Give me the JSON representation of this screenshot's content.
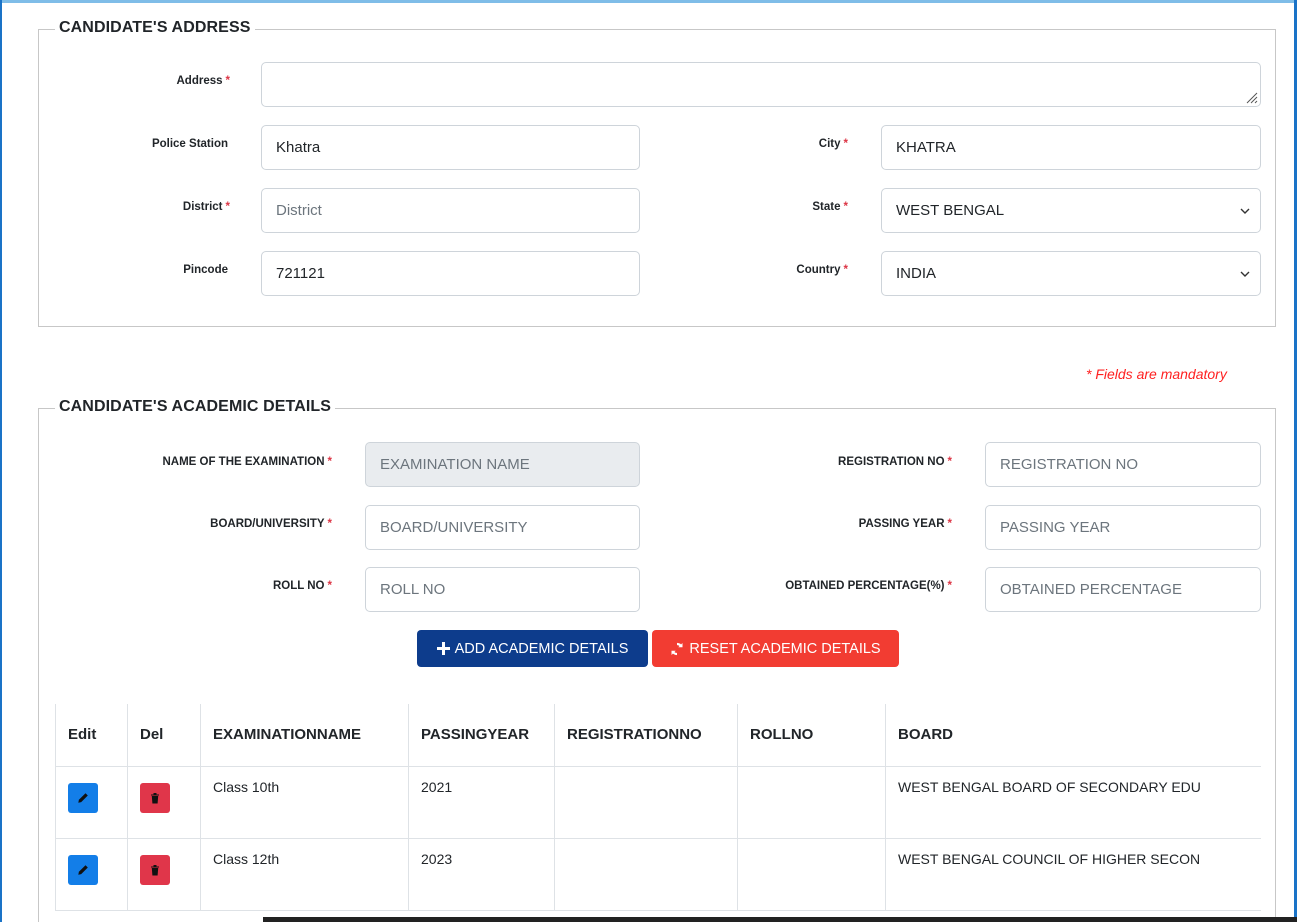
{
  "address_section": {
    "legend": "CANDIDATE'S ADDRESS",
    "address_label": "Address",
    "address_value": "",
    "police_station_label": "Police Station",
    "police_station_value": "Khatra",
    "city_label": "City",
    "city_value": "KHATRA",
    "district_label": "District",
    "district_placeholder": "District",
    "state_label": "State",
    "state_value": "WEST BENGAL",
    "pincode_label": "Pincode",
    "pincode_value": "721121",
    "country_label": "Country",
    "country_value": "INDIA",
    "required_mark": "*"
  },
  "mandatory_note": "* Fields are mandatory",
  "academic_section": {
    "legend": "CANDIDATE'S ACADEMIC DETAILS",
    "exam_name_label": "NAME OF THE EXAMINATION",
    "exam_name_placeholder": "EXAMINATION NAME",
    "registration_label": "REGISTRATION NO",
    "registration_placeholder": "REGISTRATION NO",
    "board_label": "BOARD/UNIVERSITY",
    "board_placeholder": "BOARD/UNIVERSITY",
    "passing_year_label": "PASSING YEAR",
    "passing_year_placeholder": "PASSING YEAR",
    "roll_label": "ROLL NO",
    "roll_placeholder": "ROLL NO",
    "percentage_label": "OBTAINED PERCENTAGE(%)",
    "percentage_placeholder": "OBTAINED PERCENTAGE",
    "add_button": "ADD ACADEMIC DETAILS",
    "reset_button": "RESET ACADEMIC DETAILS"
  },
  "table": {
    "headers": [
      "Edit",
      "Del",
      "EXAMINATIONNAME",
      "PASSINGYEAR",
      "REGISTRATIONNO",
      "ROLLNO",
      "BOARD"
    ],
    "rows": [
      {
        "exam": "Class 10th",
        "year": "2021",
        "reg": "",
        "roll": "",
        "board": "WEST BENGAL BOARD OF SECONDARY EDU"
      },
      {
        "exam": "Class 12th",
        "year": "2023",
        "reg": "",
        "roll": "",
        "board": "WEST BENGAL COUNCIL OF HIGHER SECON"
      }
    ]
  },
  "colors": {
    "add_button": "#0d3c8c",
    "reset_button": "#f23c32",
    "edit_icon_bg": "#137ee8",
    "delete_icon_bg": "#e0364a",
    "required": "#dc3545"
  }
}
